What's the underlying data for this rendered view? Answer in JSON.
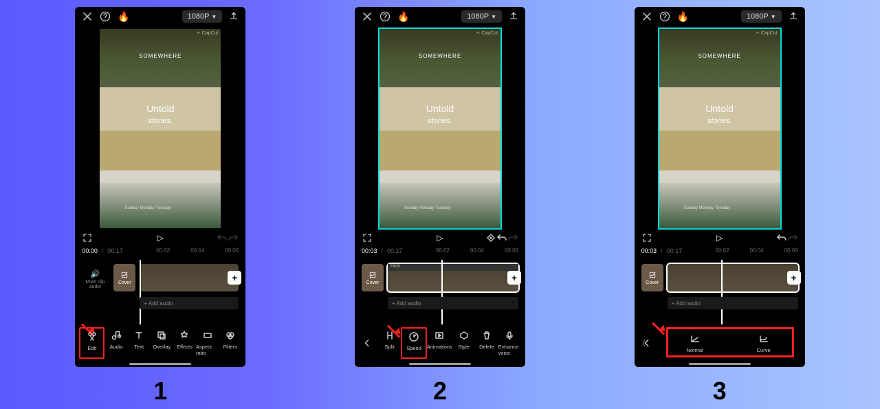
{
  "resolution": "1080P",
  "preview": {
    "watermark": "✂ CapCut",
    "title1": "SOMEWHERE",
    "title2a": "Untold",
    "title2b": "stories.",
    "days": "Sunday  Monday  Tuesday"
  },
  "time": {
    "s1_current": "00:00",
    "s2_current": "00:03",
    "s3_current": "00:03",
    "total": "00:17",
    "tick1": "00:02",
    "tick2": "00:04",
    "tick3": "00:06"
  },
  "cover": "Cover",
  "mute_label": "Mute clip audio",
  "add_audio": "+ Add audio",
  "track_hdr": "Hide",
  "tools_main": [
    {
      "id": "edit",
      "label": "Edit"
    },
    {
      "id": "audio",
      "label": "Audio"
    },
    {
      "id": "text",
      "label": "Text"
    },
    {
      "id": "overlay",
      "label": "Overlay"
    },
    {
      "id": "effects",
      "label": "Effects"
    },
    {
      "id": "aspect",
      "label": "Aspect ratio"
    },
    {
      "id": "filters",
      "label": "Filters"
    }
  ],
  "tools_edit": [
    {
      "id": "split",
      "label": "Split"
    },
    {
      "id": "speed",
      "label": "Speed"
    },
    {
      "id": "anim",
      "label": "Animations"
    },
    {
      "id": "style",
      "label": "Style"
    },
    {
      "id": "delete",
      "label": "Delete"
    },
    {
      "id": "voice",
      "label": "Enhance voice"
    }
  ],
  "tools_speed": [
    {
      "id": "normal",
      "label": "Normal"
    },
    {
      "id": "curve",
      "label": "Curve"
    }
  ],
  "steps": {
    "s1": "1",
    "s2": "2",
    "s3": "3"
  }
}
